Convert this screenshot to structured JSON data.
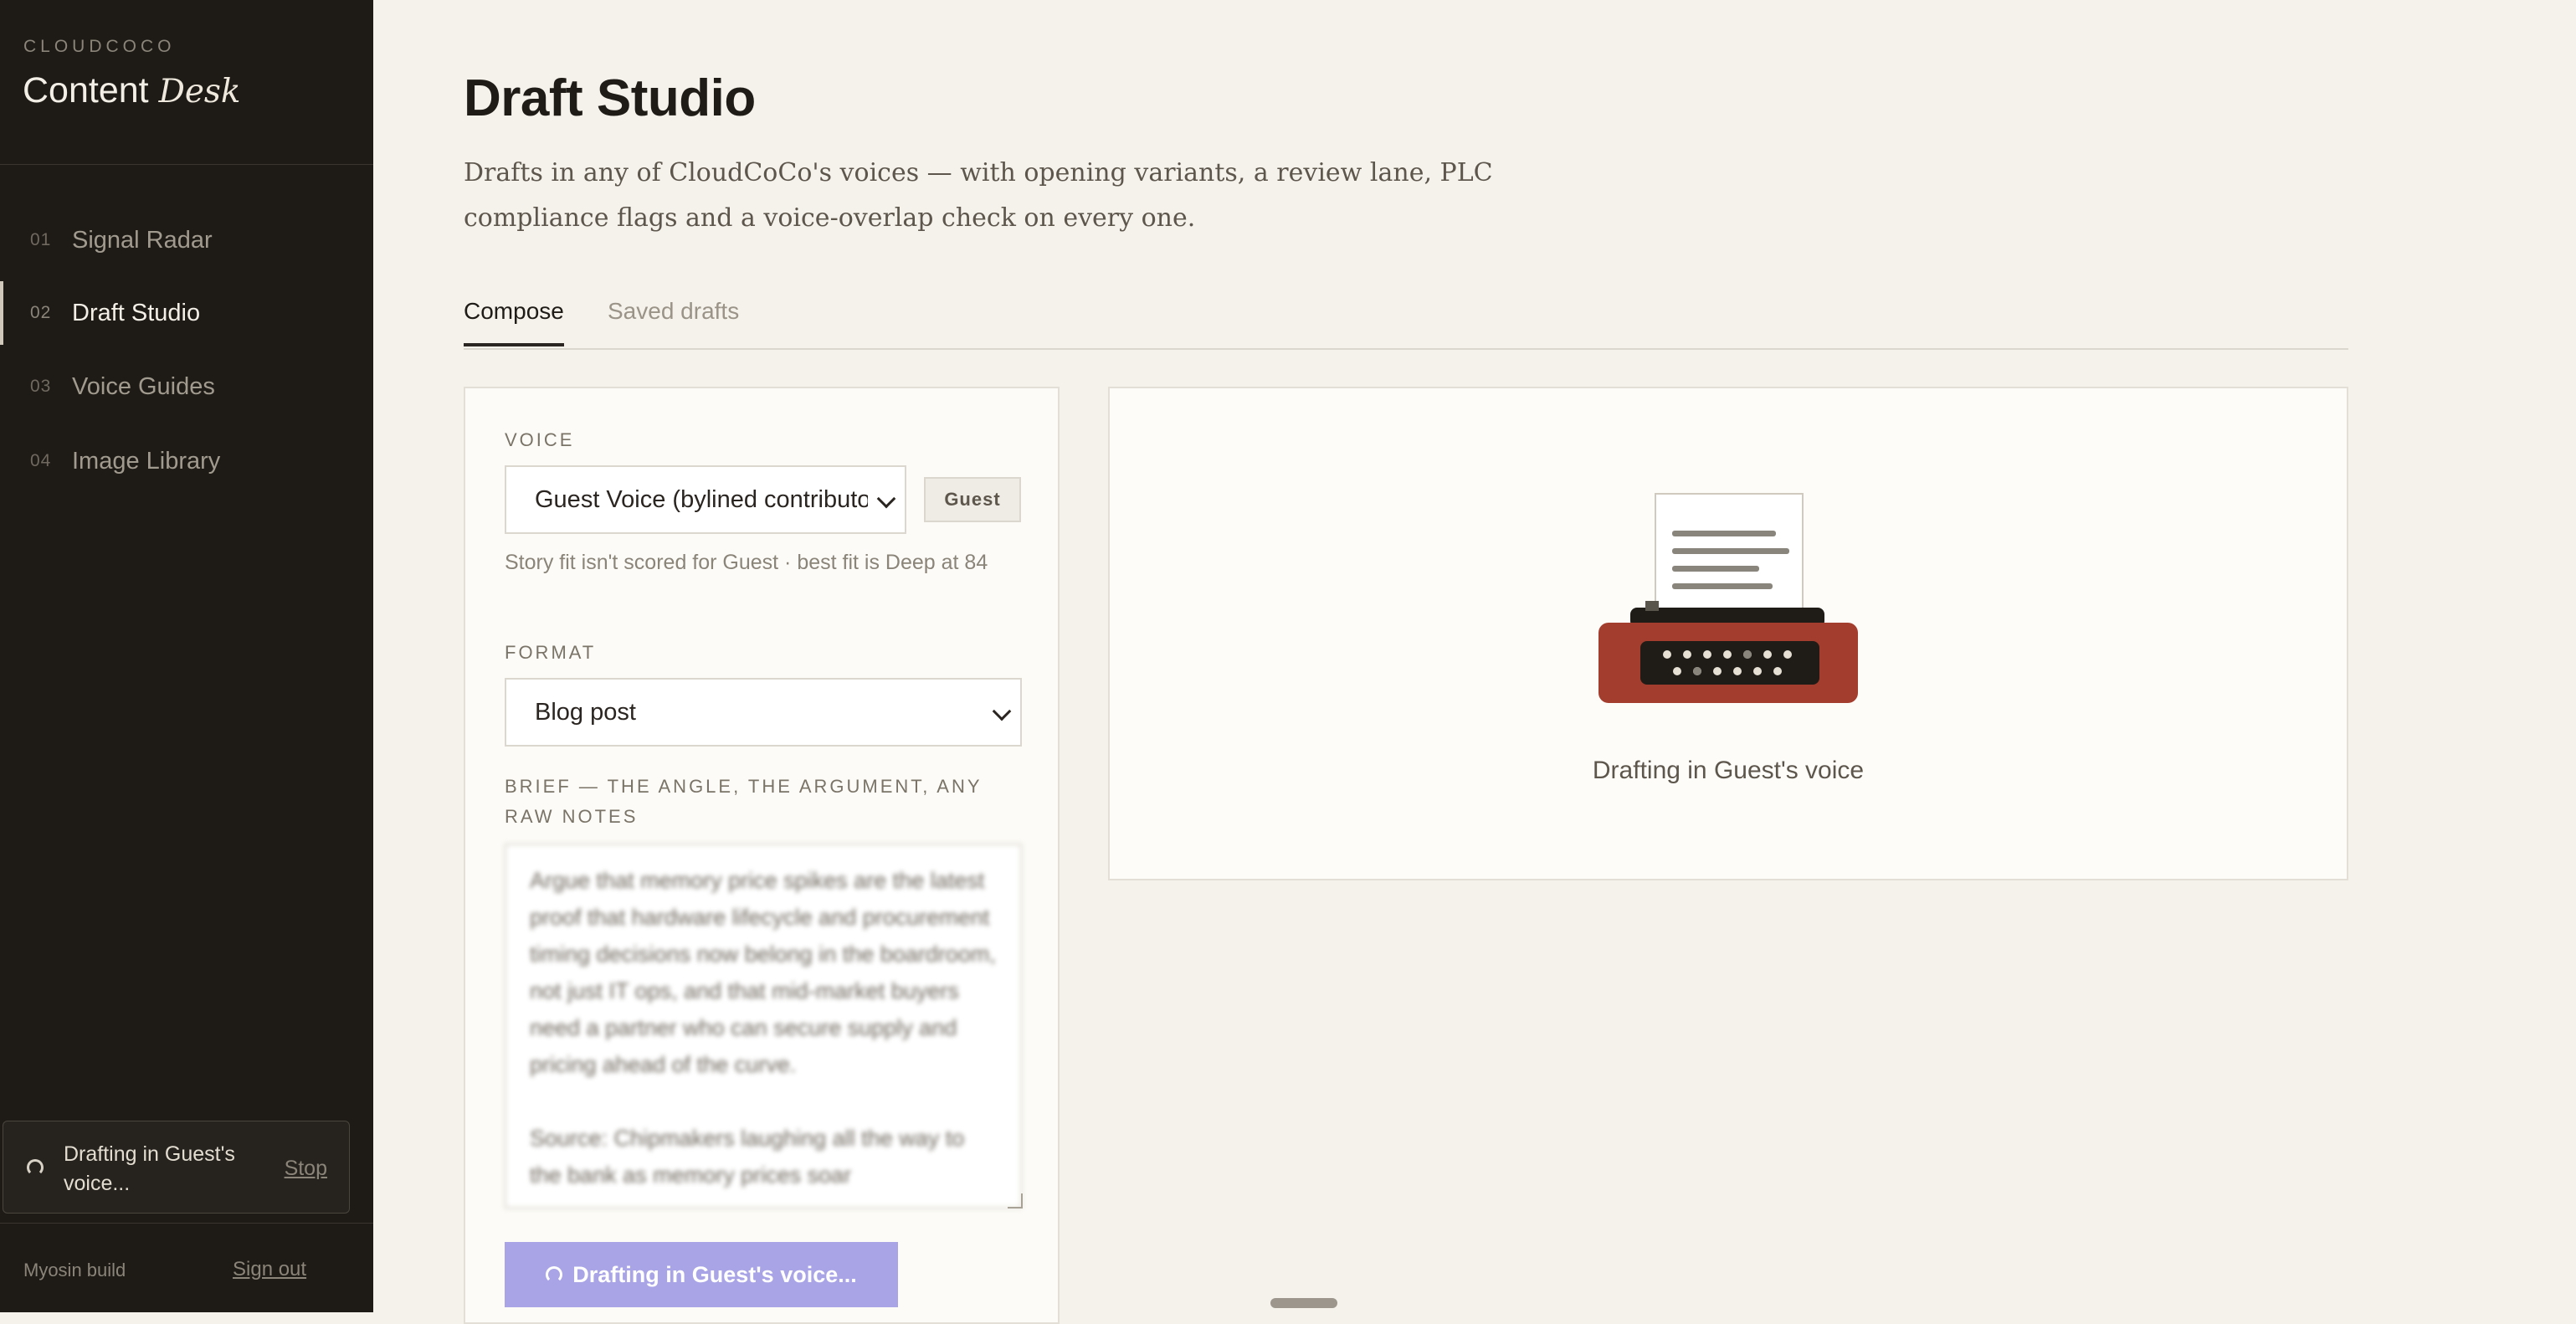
{
  "sidebar": {
    "brand_small": "CLOUDCOCO",
    "brand_main": "Content",
    "brand_italic": "Desk",
    "nav": [
      {
        "num": "01",
        "label": "Signal Radar"
      },
      {
        "num": "02",
        "label": "Draft Studio"
      },
      {
        "num": "03",
        "label": "Voice Guides"
      },
      {
        "num": "04",
        "label": "Image Library"
      }
    ],
    "status": {
      "text": "Drafting in Guest's voice...",
      "stop": "Stop"
    },
    "build": "Myosin build",
    "signout": "Sign out"
  },
  "main": {
    "title": "Draft Studio",
    "description": "Drafts in any of CloudCoCo's voices — with opening variants, a review lane, PLC compliance flags and a voice-overlap check on every one.",
    "tabs": [
      {
        "label": "Compose",
        "active": true
      },
      {
        "label": "Saved drafts",
        "active": false
      }
    ]
  },
  "form": {
    "voice_label": "VOICE",
    "voice_value": "Guest Voice (bylined contributor)",
    "voice_badge": "Guest",
    "voice_help": "Story fit isn't scored for Guest · best fit is Deep at 84",
    "format_label": "FORMAT",
    "format_value": "Blog post",
    "brief_label": "BRIEF — THE ANGLE, THE ARGUMENT, ANY RAW NOTES",
    "brief_text": "Argue that memory price spikes are the latest proof that hardware lifecycle and procurement timing decisions now belong in the boardroom, not just IT ops, and that mid-market buyers need a partner who can secure supply and pricing ahead of the curve.\n\nSource: Chipmakers laughing all the way to the bank as memory prices soar",
    "submit_label": "Drafting in Guest's voice..."
  },
  "preview": {
    "caption": "Drafting in Guest's voice"
  },
  "colors": {
    "sidebar_bg": "#1e1b17",
    "page_bg": "#f5f2ec",
    "button_bg": "#a9a4e6",
    "typewriter_body": "#a33d2e"
  }
}
